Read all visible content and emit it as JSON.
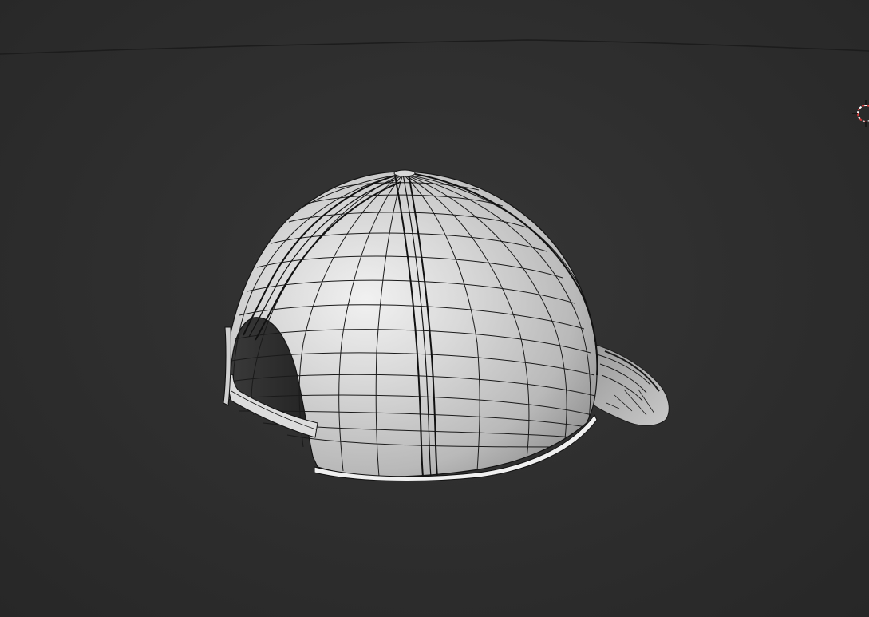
{
  "viewport": {
    "background_color": "#2e2e2e",
    "horizon_line_color": "#1c1c1c"
  },
  "object": {
    "name": "baseball-cap",
    "display": "solid-wireframe",
    "surface_color": "#b8b8b8",
    "wire_color": "#1a1a1a"
  },
  "gizmo": {
    "icon": "3d-cursor-icon",
    "colors": [
      "#d23a3a",
      "#ffffff"
    ]
  }
}
